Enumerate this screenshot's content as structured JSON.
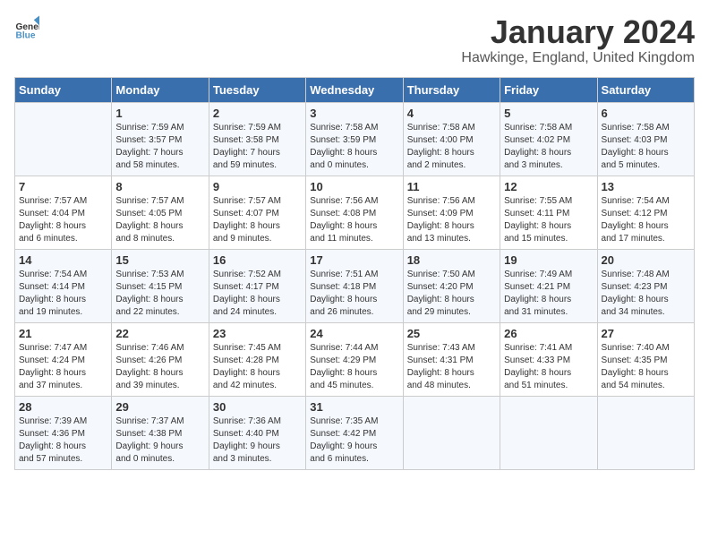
{
  "header": {
    "logo_general": "General",
    "logo_blue": "Blue",
    "month_title": "January 2024",
    "location": "Hawkinge, England, United Kingdom"
  },
  "days_of_week": [
    "Sunday",
    "Monday",
    "Tuesday",
    "Wednesday",
    "Thursday",
    "Friday",
    "Saturday"
  ],
  "weeks": [
    [
      {
        "day": "",
        "content": ""
      },
      {
        "day": "1",
        "content": "Sunrise: 7:59 AM\nSunset: 3:57 PM\nDaylight: 7 hours\nand 58 minutes."
      },
      {
        "day": "2",
        "content": "Sunrise: 7:59 AM\nSunset: 3:58 PM\nDaylight: 7 hours\nand 59 minutes."
      },
      {
        "day": "3",
        "content": "Sunrise: 7:58 AM\nSunset: 3:59 PM\nDaylight: 8 hours\nand 0 minutes."
      },
      {
        "day": "4",
        "content": "Sunrise: 7:58 AM\nSunset: 4:00 PM\nDaylight: 8 hours\nand 2 minutes."
      },
      {
        "day": "5",
        "content": "Sunrise: 7:58 AM\nSunset: 4:02 PM\nDaylight: 8 hours\nand 3 minutes."
      },
      {
        "day": "6",
        "content": "Sunrise: 7:58 AM\nSunset: 4:03 PM\nDaylight: 8 hours\nand 5 minutes."
      }
    ],
    [
      {
        "day": "7",
        "content": "Sunrise: 7:57 AM\nSunset: 4:04 PM\nDaylight: 8 hours\nand 6 minutes."
      },
      {
        "day": "8",
        "content": "Sunrise: 7:57 AM\nSunset: 4:05 PM\nDaylight: 8 hours\nand 8 minutes."
      },
      {
        "day": "9",
        "content": "Sunrise: 7:57 AM\nSunset: 4:07 PM\nDaylight: 8 hours\nand 9 minutes."
      },
      {
        "day": "10",
        "content": "Sunrise: 7:56 AM\nSunset: 4:08 PM\nDaylight: 8 hours\nand 11 minutes."
      },
      {
        "day": "11",
        "content": "Sunrise: 7:56 AM\nSunset: 4:09 PM\nDaylight: 8 hours\nand 13 minutes."
      },
      {
        "day": "12",
        "content": "Sunrise: 7:55 AM\nSunset: 4:11 PM\nDaylight: 8 hours\nand 15 minutes."
      },
      {
        "day": "13",
        "content": "Sunrise: 7:54 AM\nSunset: 4:12 PM\nDaylight: 8 hours\nand 17 minutes."
      }
    ],
    [
      {
        "day": "14",
        "content": "Sunrise: 7:54 AM\nSunset: 4:14 PM\nDaylight: 8 hours\nand 19 minutes."
      },
      {
        "day": "15",
        "content": "Sunrise: 7:53 AM\nSunset: 4:15 PM\nDaylight: 8 hours\nand 22 minutes."
      },
      {
        "day": "16",
        "content": "Sunrise: 7:52 AM\nSunset: 4:17 PM\nDaylight: 8 hours\nand 24 minutes."
      },
      {
        "day": "17",
        "content": "Sunrise: 7:51 AM\nSunset: 4:18 PM\nDaylight: 8 hours\nand 26 minutes."
      },
      {
        "day": "18",
        "content": "Sunrise: 7:50 AM\nSunset: 4:20 PM\nDaylight: 8 hours\nand 29 minutes."
      },
      {
        "day": "19",
        "content": "Sunrise: 7:49 AM\nSunset: 4:21 PM\nDaylight: 8 hours\nand 31 minutes."
      },
      {
        "day": "20",
        "content": "Sunrise: 7:48 AM\nSunset: 4:23 PM\nDaylight: 8 hours\nand 34 minutes."
      }
    ],
    [
      {
        "day": "21",
        "content": "Sunrise: 7:47 AM\nSunset: 4:24 PM\nDaylight: 8 hours\nand 37 minutes."
      },
      {
        "day": "22",
        "content": "Sunrise: 7:46 AM\nSunset: 4:26 PM\nDaylight: 8 hours\nand 39 minutes."
      },
      {
        "day": "23",
        "content": "Sunrise: 7:45 AM\nSunset: 4:28 PM\nDaylight: 8 hours\nand 42 minutes."
      },
      {
        "day": "24",
        "content": "Sunrise: 7:44 AM\nSunset: 4:29 PM\nDaylight: 8 hours\nand 45 minutes."
      },
      {
        "day": "25",
        "content": "Sunrise: 7:43 AM\nSunset: 4:31 PM\nDaylight: 8 hours\nand 48 minutes."
      },
      {
        "day": "26",
        "content": "Sunrise: 7:41 AM\nSunset: 4:33 PM\nDaylight: 8 hours\nand 51 minutes."
      },
      {
        "day": "27",
        "content": "Sunrise: 7:40 AM\nSunset: 4:35 PM\nDaylight: 8 hours\nand 54 minutes."
      }
    ],
    [
      {
        "day": "28",
        "content": "Sunrise: 7:39 AM\nSunset: 4:36 PM\nDaylight: 8 hours\nand 57 minutes."
      },
      {
        "day": "29",
        "content": "Sunrise: 7:37 AM\nSunset: 4:38 PM\nDaylight: 9 hours\nand 0 minutes."
      },
      {
        "day": "30",
        "content": "Sunrise: 7:36 AM\nSunset: 4:40 PM\nDaylight: 9 hours\nand 3 minutes."
      },
      {
        "day": "31",
        "content": "Sunrise: 7:35 AM\nSunset: 4:42 PM\nDaylight: 9 hours\nand 6 minutes."
      },
      {
        "day": "",
        "content": ""
      },
      {
        "day": "",
        "content": ""
      },
      {
        "day": "",
        "content": ""
      }
    ]
  ]
}
